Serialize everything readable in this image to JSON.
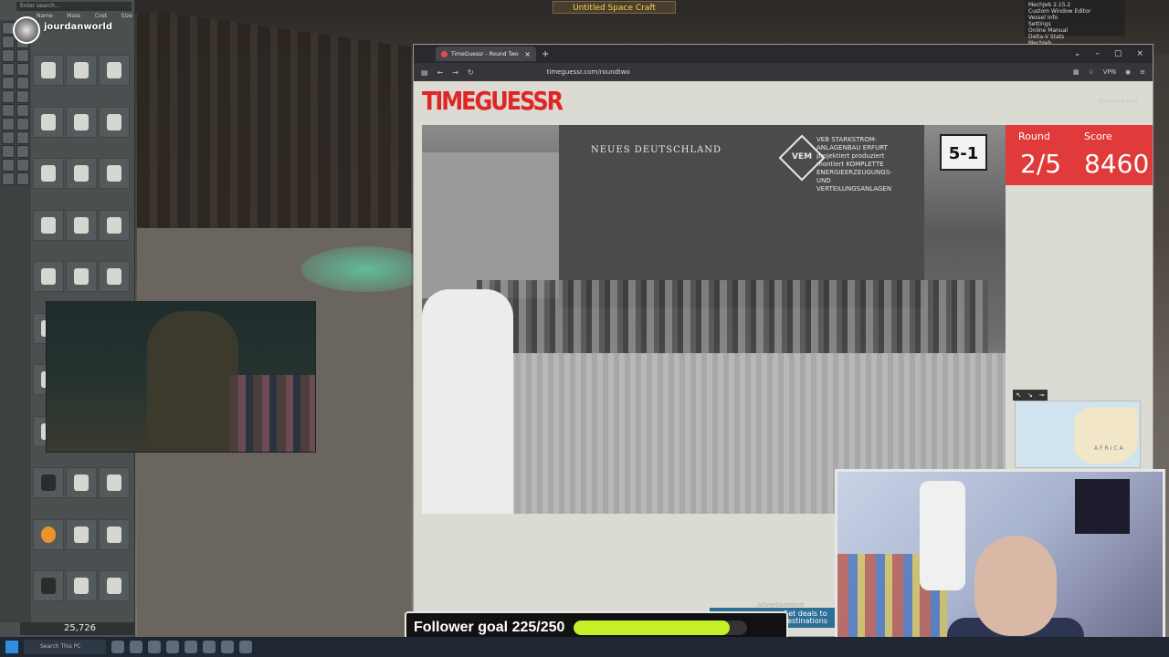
{
  "game": {
    "window_title": "Untitled Space Craft",
    "mechjeb": [
      "MechJeb 2.15.2",
      "Custom Window Editor",
      "Vessel Info",
      "Settings",
      "Online Manual",
      "Delta-V Stats",
      "MechJeb"
    ],
    "parts_search_placeholder": "Enter search...",
    "columns": [
      "Name",
      "Mass",
      "Cost",
      "Size"
    ],
    "funds": "25,726",
    "username": "jourdanworld"
  },
  "browser": {
    "tab_title": "TimeGuessr - Round Two",
    "url": "timeguessr.com/roundtwo",
    "vpn_label": "VPN"
  },
  "timeguessr": {
    "logo": "TIMEGUESSR",
    "signin_hint": "Remove ads",
    "round_label": "Round",
    "round_value": "2/5",
    "score_label": "Score",
    "score_value": "8460",
    "photo_sign": "NEUES DEUTSCHLAND",
    "photo_brand": "VEM",
    "photo_slogan": "VEB STARKSTROM-ANLAGENBAU ERFURT projektiert produziert montiert KOMPLETTE ENERGIEERZEUGUNGS- UND VERTEILUNGSANLAGEN",
    "plate": "5-1",
    "map_label": "AFRICA",
    "ad_label": "Advertisement",
    "ad_text": "Get deals to destinations"
  },
  "stream": {
    "goal_label": "Follower goal 225/250",
    "goal_progress": 0.9,
    "accent": "#c6f028"
  },
  "taskbar": {
    "search_placeholder": "Search This PC"
  }
}
